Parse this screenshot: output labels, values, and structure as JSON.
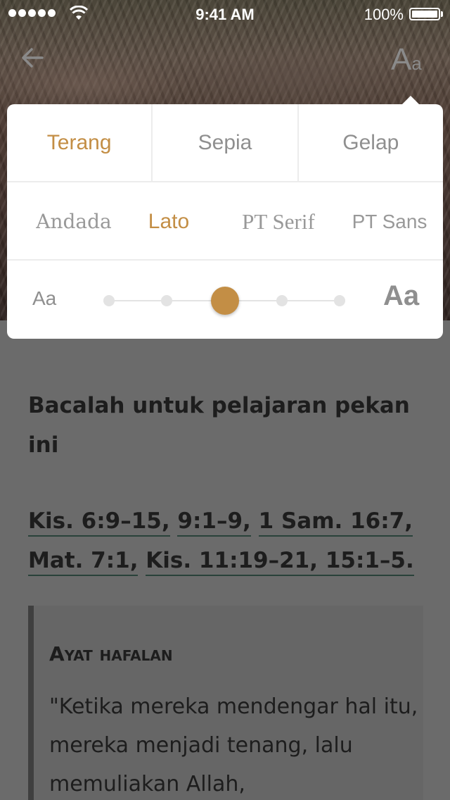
{
  "status_bar": {
    "time": "9:41 AM",
    "battery": "100%"
  },
  "nav": {
    "font_button_big": "A",
    "font_button_small": "a"
  },
  "settings": {
    "themes": [
      {
        "label": "Terang",
        "active": true
      },
      {
        "label": "Sepia",
        "active": false
      },
      {
        "label": "Gelap",
        "active": false
      }
    ],
    "fonts": [
      {
        "label": "Andada",
        "active": false
      },
      {
        "label": "Lato",
        "active": true
      },
      {
        "label": "PT Serif",
        "active": false
      },
      {
        "label": "PT Sans",
        "active": false
      }
    ],
    "size": {
      "small_label": "Aa",
      "large_label": "Aa",
      "steps": 5,
      "selected_step": 3
    }
  },
  "content": {
    "heading": "Bacalah untuk pelajaran pekan ini",
    "references": [
      "Kis. 6:9–15,",
      "9:1–9,",
      "1 Sam. 16:7,",
      "Mat. 7:1,",
      "Kis. 11:19–21, 15:1–5."
    ],
    "memory_title": "Ayat hafalan",
    "memory_text": "\"Ketika mereka mendengar hal itu, mereka menjadi tenang, lalu memuliakan Allah,"
  },
  "colors": {
    "accent": "#c38e45",
    "link_underline": "#29423a"
  }
}
